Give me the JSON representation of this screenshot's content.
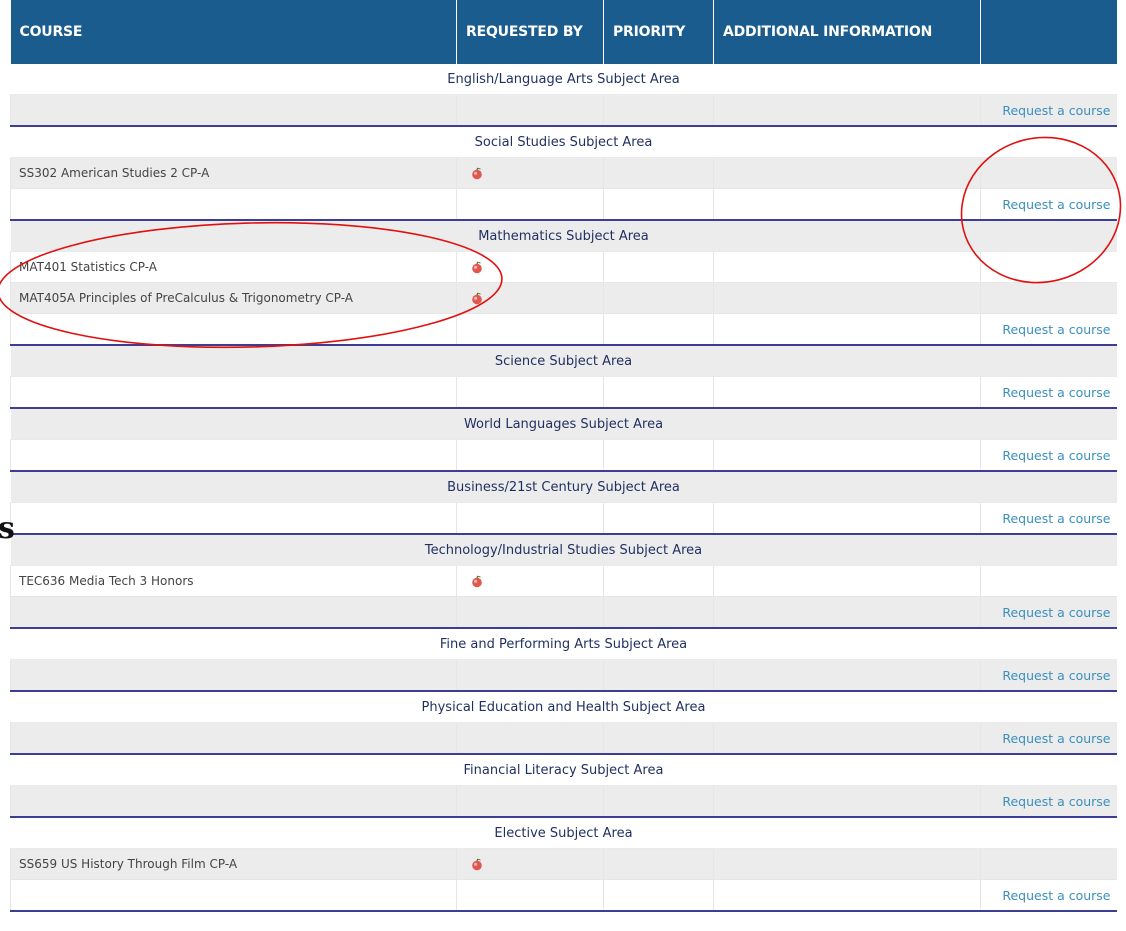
{
  "table": {
    "headers": [
      "COURSE",
      "REQUESTED BY",
      "PRIORITY",
      "ADDITIONAL INFORMATION",
      ""
    ],
    "request_link_label": "Request a course",
    "subject_areas": [
      {
        "name": "English/Language Arts Subject Area",
        "courses": []
      },
      {
        "name": "Social Studies Subject Area",
        "courses": [
          {
            "course": "SS302   American Studies 2 CP-A"
          }
        ]
      },
      {
        "name": "Mathematics Subject Area",
        "courses": [
          {
            "course": "MAT401   Statistics CP-A"
          },
          {
            "course": "MAT405A   Principles of PreCalculus & Trigonometry CP-A"
          }
        ]
      },
      {
        "name": "Science Subject Area",
        "courses": []
      },
      {
        "name": "World Languages Subject Area",
        "courses": []
      },
      {
        "name": "Business/21st Century Subject Area",
        "courses": []
      },
      {
        "name": "Technology/Industrial Studies Subject Area",
        "courses": [
          {
            "course": "TEC636   Media Tech 3 Honors"
          }
        ]
      },
      {
        "name": "Fine and Performing Arts Subject Area",
        "courses": []
      },
      {
        "name": "Physical Education and Health Subject Area",
        "courses": []
      },
      {
        "name": "Financial Literacy Subject Area",
        "courses": []
      },
      {
        "name": "Elective Subject Area",
        "courses": [
          {
            "course": "SS659   US History Through Film CP-A"
          }
        ]
      }
    ]
  },
  "stray_text": "s",
  "colors": {
    "header_bg": "#1a5c8e",
    "link": "#3a8fbc",
    "subject_text": "#1f2f5f",
    "annotation": "#e01010",
    "apple_icon": "#e0574f"
  }
}
